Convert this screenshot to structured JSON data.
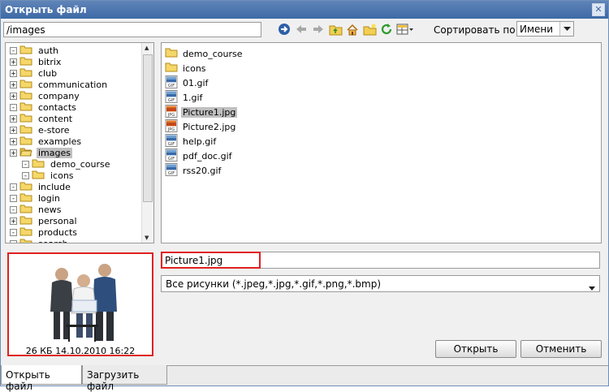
{
  "window": {
    "title": "Открыть файл"
  },
  "path": {
    "value": "/images"
  },
  "sort": {
    "label": "Сортировать по:",
    "value": "Имени"
  },
  "tree": {
    "items": [
      {
        "label": "auth",
        "expander": "-"
      },
      {
        "label": "bitrix",
        "expander": "+"
      },
      {
        "label": "club",
        "expander": "+"
      },
      {
        "label": "communication",
        "expander": "+"
      },
      {
        "label": "company",
        "expander": "+"
      },
      {
        "label": "contacts",
        "expander": "-"
      },
      {
        "label": "content",
        "expander": "+"
      },
      {
        "label": "e-store",
        "expander": "+"
      },
      {
        "label": "examples",
        "expander": "+"
      },
      {
        "label": "images",
        "expander": "+"
      },
      {
        "label": "demo_course",
        "expander": "-"
      },
      {
        "label": "icons",
        "expander": "-"
      },
      {
        "label": "include",
        "expander": "-"
      },
      {
        "label": "login",
        "expander": "-"
      },
      {
        "label": "news",
        "expander": "-"
      },
      {
        "label": "personal",
        "expander": "+"
      },
      {
        "label": "products",
        "expander": "-"
      },
      {
        "label": "search",
        "expander": "-"
      }
    ]
  },
  "files": {
    "items": [
      {
        "name": "demo_course",
        "type": "folder"
      },
      {
        "name": "icons",
        "type": "folder"
      },
      {
        "name": "01.gif",
        "type": "gif"
      },
      {
        "name": "1.gif",
        "type": "gif"
      },
      {
        "name": "Picture1.jpg",
        "type": "jpg"
      },
      {
        "name": "Picture2.jpg",
        "type": "jpg"
      },
      {
        "name": "help.gif",
        "type": "gif"
      },
      {
        "name": "pdf_doc.gif",
        "type": "gif"
      },
      {
        "name": "rss20.gif",
        "type": "gif"
      }
    ]
  },
  "preview": {
    "caption": "26 КБ 14.10.2010 16:22"
  },
  "filename": {
    "value": "Picture1.jpg"
  },
  "filter": {
    "value": "Все рисунки (*.jpeg,*.jpg,*.gif,*.png,*.bmp)"
  },
  "buttons": {
    "open": "Открыть",
    "cancel": "Отменить"
  },
  "tabs": {
    "open_file": "Открыть файл",
    "upload_file": "Загрузить файл"
  },
  "colors": {
    "title_bar": "#4a74ae",
    "highlight_border": "#e02020",
    "selection": "#c0c0c0",
    "folder": "#f5d76a"
  },
  "icons": {
    "toolbar": [
      "go-arrow-icon",
      "back-arrow-icon",
      "forward-arrow-icon",
      "up-folder-icon",
      "home-icon",
      "new-folder-icon",
      "refresh-icon",
      "view-mode-icon"
    ]
  }
}
